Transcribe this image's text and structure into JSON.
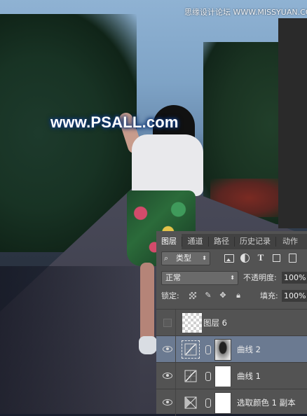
{
  "watermarks": {
    "top_right": "思缘设计论坛 WWW.MISSYUAN.COM",
    "center": "www.PSALL.com"
  },
  "layers_panel": {
    "tabs": [
      {
        "label": "图层",
        "active": true
      },
      {
        "label": "通道",
        "active": false
      },
      {
        "label": "路径",
        "active": false
      },
      {
        "label": "历史记录",
        "active": false
      },
      {
        "label": "动作",
        "active": false
      }
    ],
    "filter": {
      "kind_label": "类型",
      "icons": [
        "image-filter-icon",
        "adjustment-filter-icon",
        "type-filter-icon",
        "shape-filter-icon",
        "smart-object-filter-icon"
      ]
    },
    "blend_mode": "正常",
    "opacity_label": "不透明度:",
    "opacity_value": "100%",
    "lock_label": "锁定:",
    "fill_label": "填充:",
    "fill_value": "100%",
    "layers": [
      {
        "name": "图层 6",
        "visible": false,
        "selected": false,
        "thumbnail": "transparent-pixel-thumbnail"
      },
      {
        "name": "曲线 2",
        "visible": true,
        "selected": true,
        "thumbnail": "curves-adjustment-icon",
        "mask": "figure-mask"
      },
      {
        "name": "曲线 1",
        "visible": true,
        "selected": false,
        "thumbnail": "curves-adjustment-icon",
        "mask": "white-mask"
      },
      {
        "name": "选取颜色 1 副本",
        "visible": true,
        "selected": false,
        "thumbnail": "selective-color-adjustment-icon",
        "mask": "white-mask"
      }
    ]
  },
  "colors": {
    "panel_bg": "#535353",
    "tab_bar_bg": "#424242",
    "selected_layer_bg": "#6b7a91",
    "watermark_glow": "#123a7a"
  }
}
